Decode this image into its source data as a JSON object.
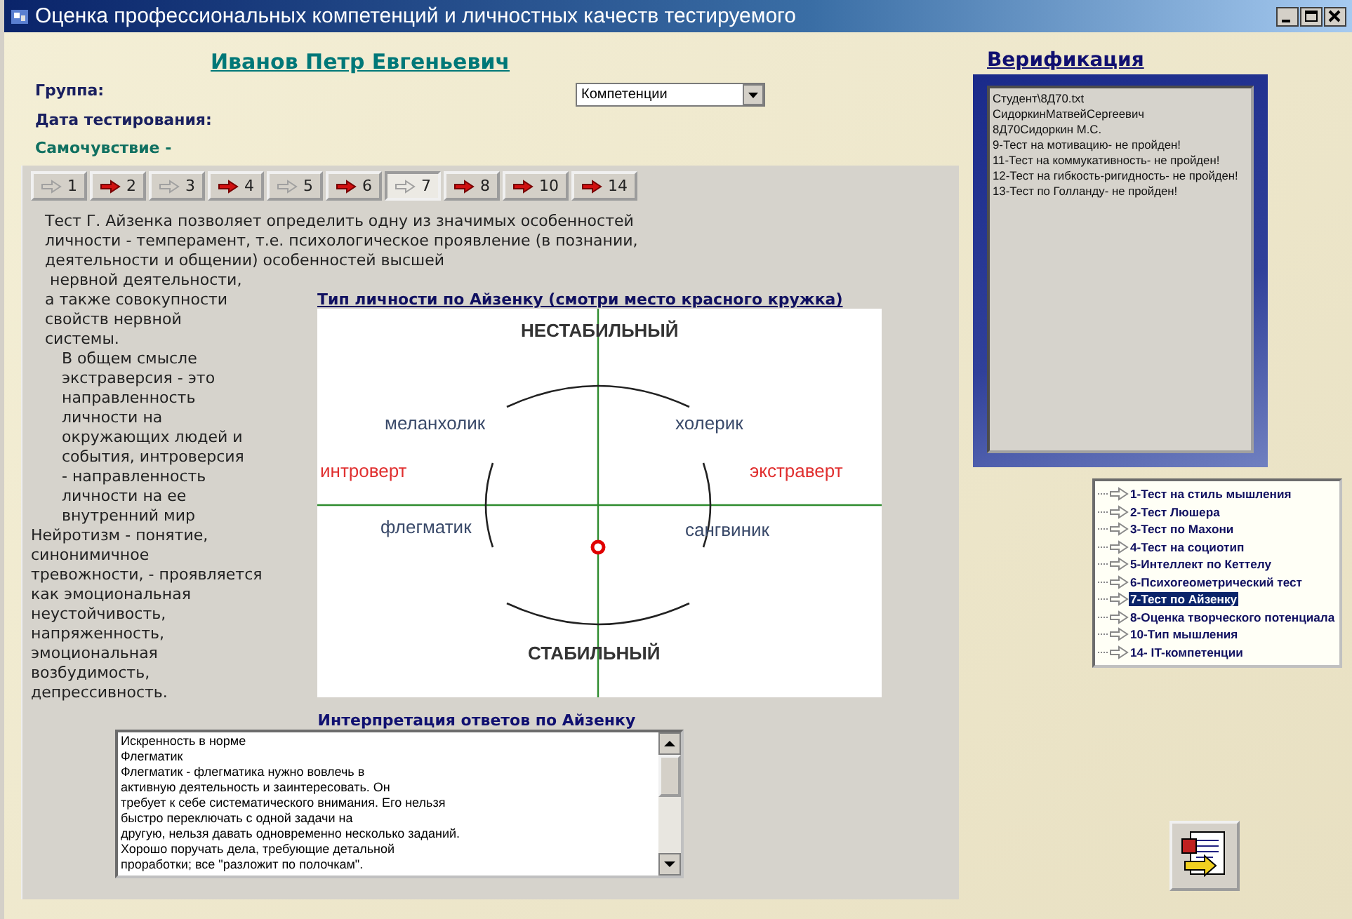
{
  "window": {
    "title": "Оценка профессиональных компетенций и личностных качеств тестируемого"
  },
  "header": {
    "name": "Иванов Петр Евгеньевич",
    "group_label": "Группа:",
    "date_label": "Дата тестирования:",
    "wellbeing_label": "Самочувствие -",
    "dropdown": {
      "value": "Компетенции"
    }
  },
  "tabs": [
    {
      "label": "1",
      "kind": "hollow",
      "selected": false
    },
    {
      "label": "2",
      "kind": "red",
      "selected": false
    },
    {
      "label": "3",
      "kind": "hollow",
      "selected": false
    },
    {
      "label": "4",
      "kind": "red",
      "selected": false
    },
    {
      "label": "5",
      "kind": "hollow",
      "selected": false
    },
    {
      "label": "6",
      "kind": "red",
      "selected": false
    },
    {
      "label": "7",
      "kind": "hollow",
      "selected": true
    },
    {
      "label": "8",
      "kind": "red",
      "selected": false
    },
    {
      "label": "10",
      "kind": "red",
      "selected": false
    },
    {
      "label": "14",
      "kind": "red",
      "selected": false
    }
  ],
  "intro": [
    "Тест Г. Айзенка позволяет определить одну из значимых особенностей",
    "личности - темперамент, т.е.  психологическое проявление (в познании,",
    "деятельности и общении) особенностей высшей"
  ],
  "side_text": [
    {
      "kind": "plain",
      "lines": [
        " нервной деятельности,",
        "а также совокупности",
        "свойств нервной",
        "системы."
      ]
    },
    {
      "kind": "indented",
      "lines": [
        "В общем смысле",
        "экстраверсия - это",
        "направленность",
        "личности на",
        "окружающих людей и",
        "события, интроверсия",
        "- направленность",
        "личности на ее",
        "внутренний мир"
      ]
    },
    {
      "kind": "plain",
      "lines": [
        "Нейротизм - понятие,",
        "синонимичное",
        "тревожности, - проявляется",
        "как эмоциональная",
        "неустойчивость,",
        "напряженность,",
        "эмоциональная",
        "возбудимость,",
        "депрессивность."
      ]
    }
  ],
  "chart_title": "Тип личности по Айзенку (смотри место красного кружка)",
  "diagram": {
    "top": "НЕСТАБИЛЬНЫЙ",
    "bottom": "СТАБИЛЬНЫЙ",
    "left": "интроверт",
    "right": "экстраверт",
    "quadrants": [
      "меланхолик",
      "холерик",
      "флегматик",
      "сангвиник"
    ]
  },
  "interpretation": {
    "title": "Интерпретация  ответов по Айзенку",
    "lines": [
      "Искренность в норме",
      "Флегматик",
      "Флегматик - флегматика нужно вовлечь в",
      "активную деятельность и заинтересовать. Он",
      "требует к себе систематического внимания. Его нельзя",
      "быстро переключать с одной задачи на",
      "другую, нельзя давать одновременно несколько заданий.",
      "Хорошо поручать дела, требующие детальной",
      "проработки; все \"разложит по полочкам\"."
    ]
  },
  "verification": {
    "title": "Верификация",
    "lines": [
      "Студент\\8Д70.txt",
      "СидоркинМатвейСергеевич",
      "8Д70Сидоркин М.С.",
      "9-Тест на мотивацию- не пройден!",
      "11-Тест на коммукативность- не пройден!",
      "12-Тест на гибкость-ригидность- не пройден!",
      "13-Тест по Голланду- не пройден!"
    ]
  },
  "tests": [
    {
      "label": "1-Тест на стиль мышления",
      "selected": false
    },
    {
      "label": "2-Тест Люшера",
      "selected": false
    },
    {
      "label": "3-Тест по Махони",
      "selected": false
    },
    {
      "label": "4-Тест на социотип",
      "selected": false
    },
    {
      "label": "5-Интеллект по Кеттелу",
      "selected": false
    },
    {
      "label": "6-Психогеометрический тест",
      "selected": false
    },
    {
      "label": "7-Тест по Айзенку",
      "selected": true
    },
    {
      "label": "8-Оценка творческого потенциала",
      "selected": false
    },
    {
      "label": "10-Тип мышления",
      "selected": false
    },
    {
      "label": "14- IT-компетенции",
      "selected": false
    }
  ]
}
